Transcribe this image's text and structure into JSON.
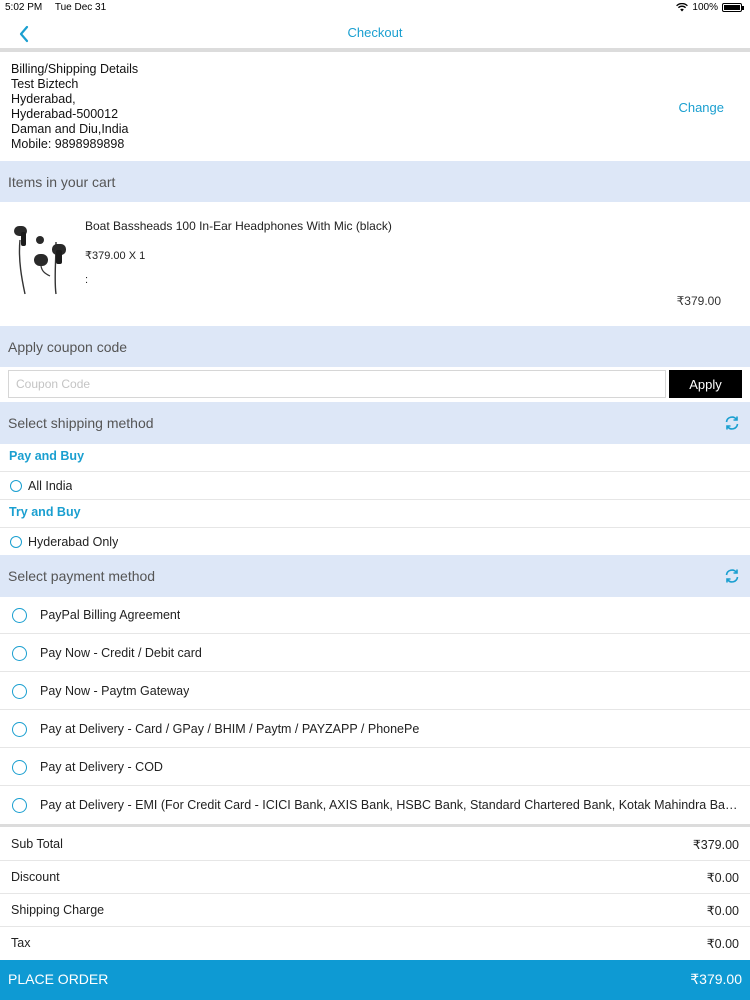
{
  "status_bar": {
    "time": "5:02 PM",
    "date": "Tue Dec 31",
    "battery": "100%"
  },
  "header": {
    "title": "Checkout",
    "back_icon": "chevron-left-icon"
  },
  "address": {
    "heading": "Billing/Shipping Details",
    "name": "Test Biztech",
    "line1": "Hyderabad,",
    "line2": "Hyderabad-500012",
    "line3": "Daman and Diu,India",
    "mobile": "Mobile: 9898989898",
    "change_label": "Change"
  },
  "cart": {
    "header": "Items in your cart",
    "items": [
      {
        "name": "Boat Bassheads 100 In-Ear Headphones With Mic (black)",
        "price_qty": "₹379.00 X 1",
        "options": ":",
        "total": "₹379.00"
      }
    ]
  },
  "coupon": {
    "header": "Apply coupon code",
    "placeholder": "Coupon Code",
    "value": "",
    "apply_label": "Apply"
  },
  "shipping": {
    "header": "Select shipping method",
    "groups": [
      {
        "title": "Pay and Buy",
        "option": "All India"
      },
      {
        "title": "Try and Buy",
        "option": "Hyderabad Only"
      }
    ]
  },
  "payment": {
    "header": "Select payment method",
    "options": [
      "PayPal Billing Agreement",
      "Pay Now - Credit / Debit card",
      "Pay Now - Paytm Gateway",
      "Pay at Delivery - Card / GPay / BHIM / Paytm / PAYZAPP / PhonePe",
      "Pay at Delivery - COD",
      "Pay at Delivery - EMI (For Credit Card - ICICI Bank, AXIS Bank, HSBC Bank, Standard Chartered Bank, Kotak Mahindra Bank..."
    ]
  },
  "totals": [
    {
      "label": "Sub Total",
      "value": "₹379.00"
    },
    {
      "label": "Discount",
      "value": "₹0.00"
    },
    {
      "label": "Shipping Charge",
      "value": "₹0.00"
    },
    {
      "label": "Tax",
      "value": "₹0.00"
    }
  ],
  "place_order": {
    "label": "PLACE ORDER",
    "amount": "₹379.00"
  },
  "colors": {
    "accent": "#1a9fd0",
    "section_bg": "#dde7f7",
    "place_order_bg": "#0e9ad3",
    "apply_bg": "#000000"
  }
}
